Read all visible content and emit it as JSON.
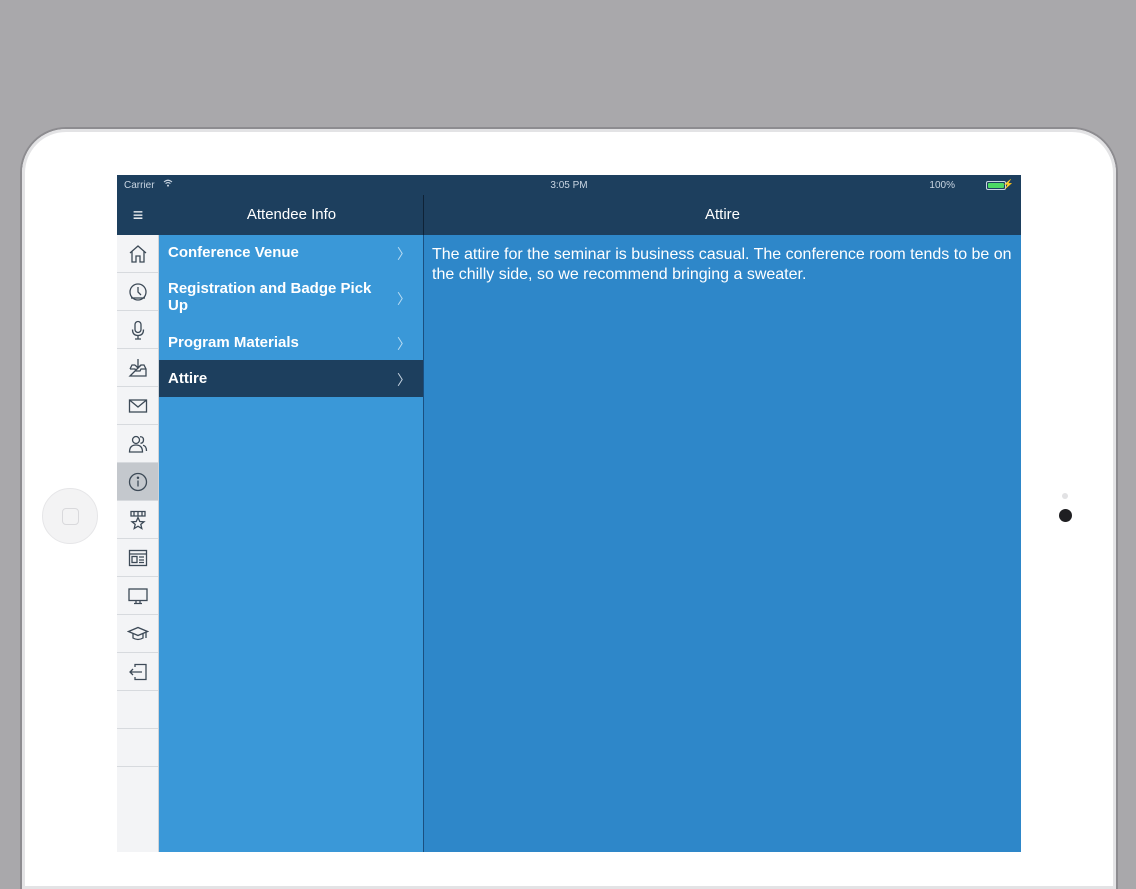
{
  "status_bar": {
    "carrier": "Carrier",
    "wifi_icon": "wifi-icon",
    "time": "3:05 PM",
    "battery": "100%",
    "battery_level_percent": 100,
    "battery_color": "#4cd964"
  },
  "nav": {
    "menu_icon": "hamburger-menu-icon",
    "left_title": "Attendee Info",
    "right_title": "Attire"
  },
  "rail": {
    "items": [
      {
        "icon": "home-icon",
        "active": false
      },
      {
        "icon": "clock-icon",
        "active": false
      },
      {
        "icon": "microphone-icon",
        "active": false
      },
      {
        "icon": "inbox-download-icon",
        "active": false
      },
      {
        "icon": "envelope-icon",
        "active": false
      },
      {
        "icon": "people-icon",
        "active": false
      },
      {
        "icon": "info-icon",
        "active": true
      },
      {
        "icon": "ribbon-star-icon",
        "active": false
      },
      {
        "icon": "browser-window-icon",
        "active": false
      },
      {
        "icon": "monitor-icon",
        "active": false
      },
      {
        "icon": "graduation-cap-icon",
        "active": false
      },
      {
        "icon": "logout-icon",
        "active": false
      }
    ]
  },
  "master": {
    "items": [
      {
        "label": "Conference Venue",
        "selected": false
      },
      {
        "label": "Registration and Badge Pick Up",
        "selected": false
      },
      {
        "label": "Program Materials",
        "selected": false
      },
      {
        "label": "Attire",
        "selected": true
      }
    ],
    "chevron": "〉"
  },
  "detail": {
    "text": "The attire for the seminar is business casual. The conference room tends to be on the chilly side, so we recommend bringing a sweater."
  },
  "colors": {
    "nav_background": "#1d3f5e",
    "master_background": "#3a98d8",
    "detail_background": "#2e87c9",
    "selected_row": "#1d3f5e"
  }
}
